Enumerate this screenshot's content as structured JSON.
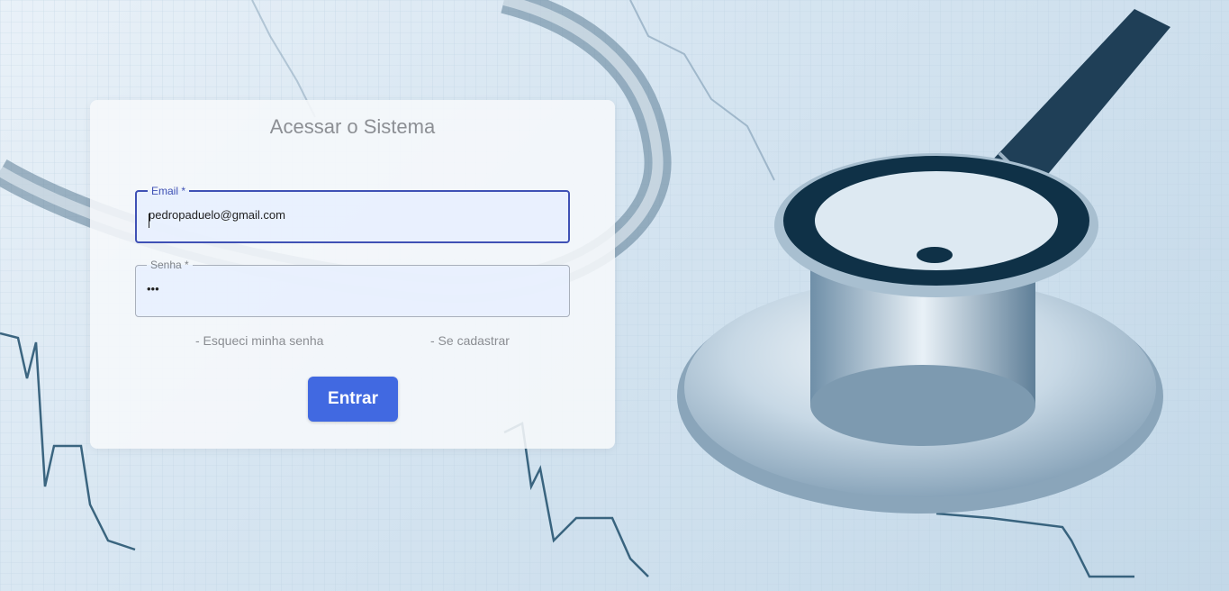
{
  "login": {
    "title": "Acessar o Sistema",
    "email": {
      "label": "Email *",
      "value": "pedropaduelo@gmail.com"
    },
    "password": {
      "label": "Senha *",
      "value": "•••"
    },
    "links": {
      "forgot": "- Esqueci minha senha",
      "register": "- Se cadastrar"
    },
    "submit_label": "Entrar"
  },
  "colors": {
    "accent": "#3f51b5",
    "button": "#4169e1",
    "input_bg": "#e8f0fe"
  },
  "icons": {
    "background": "stethoscope-ecg-photo"
  }
}
